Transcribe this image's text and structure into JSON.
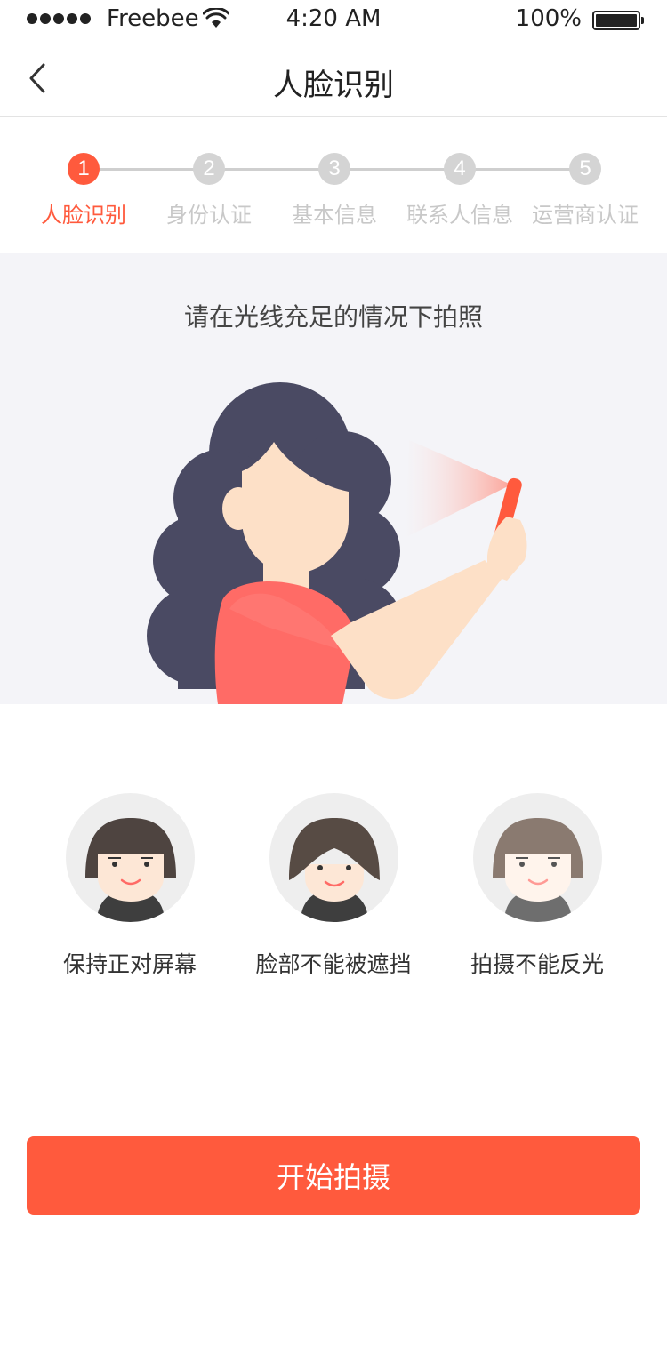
{
  "status_bar": {
    "carrier": "Freebee",
    "time": "4:20 AM",
    "battery": "100%",
    "battery_level": 1.0,
    "icons": [
      "signal-dots-icon",
      "wifi-icon",
      "battery-icon"
    ]
  },
  "nav": {
    "title": "人脸识别",
    "back_icon": "chevron-left-icon"
  },
  "steps": {
    "active_index": 0,
    "items": [
      {
        "number": "1",
        "label": "人脸识别"
      },
      {
        "number": "2",
        "label": "身份认证"
      },
      {
        "number": "3",
        "label": "基本信息"
      },
      {
        "number": "4",
        "label": "联系人信息"
      },
      {
        "number": "5",
        "label": "运营商认证"
      }
    ]
  },
  "hero": {
    "instruction": "请在光线充足的情况下拍照"
  },
  "tips": [
    {
      "label": "保持正对屏幕"
    },
    {
      "label": "脸部不能被遮挡"
    },
    {
      "label": "拍摄不能反光"
    }
  ],
  "actions": {
    "start_label": "开始拍摄"
  },
  "colors": {
    "accent": "#ff5a3d",
    "hero_bg": "#f4f4f8",
    "hair": "#4a4a63",
    "shirt": "#ff6b66",
    "skin": "#fde0c7"
  }
}
